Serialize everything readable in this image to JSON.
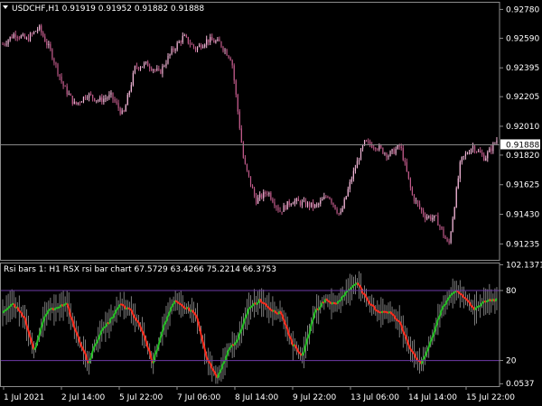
{
  "header": {
    "menu_icon": "triangle-down-icon",
    "title": "USDCHF,H1  0.91919 0.91952 0.91882 0.91888"
  },
  "indicator_header": "Rsi bars 1: H1 RSX rsi bar chart 67.5729 63.4266 75.2214 66.3753",
  "current_price_tag": "0.91888",
  "colors": {
    "background": "#000000",
    "bull_candle": "#f4b6d8",
    "bear_candle": "#c05a8a",
    "rsx_up": "#22c022",
    "rsx_down": "#ff2a1a",
    "hist_bars": "#9a9a9a",
    "level_lines": "#6e3aa8",
    "axis_frame": "#8c8c8c",
    "price_line": "#888888"
  },
  "chart_data": [
    {
      "type": "line",
      "title": "USDCHF,H1  0.91919 0.91952 0.91882 0.91888",
      "subtype": "candlestick",
      "yticks": [
        "0.92780",
        "0.92590",
        "0.92395",
        "0.92205",
        "0.92010",
        "0.91820",
        "0.91625",
        "0.91430",
        "0.91235"
      ],
      "ylim": [
        0.9113,
        0.9283
      ],
      "current_price": 0.91888,
      "x_keypoints": [
        0,
        0.02,
        0.05,
        0.08,
        0.1,
        0.12,
        0.14,
        0.16,
        0.2,
        0.24,
        0.26,
        0.3,
        0.33,
        0.36,
        0.4,
        0.41,
        0.42,
        0.44,
        0.48,
        0.5,
        0.53,
        0.56,
        0.6,
        0.63,
        0.67,
        0.7,
        0.72,
        0.74,
        0.77,
        0.79,
        0.8,
        0.82,
        0.85,
        0.88,
        0.9,
        0.92,
        0.95,
        1.0
      ],
      "y_keypoints": [
        0.9255,
        0.9262,
        0.9258,
        0.9266,
        0.925,
        0.9228,
        0.9215,
        0.9222,
        0.9218,
        0.9221,
        0.9208,
        0.924,
        0.9242,
        0.9236,
        0.925,
        0.926,
        0.9252,
        0.9258,
        0.9256,
        0.9245,
        0.9178,
        0.9152,
        0.9158,
        0.9145,
        0.9152,
        0.915,
        0.9148,
        0.9156,
        0.9142,
        0.9168,
        0.919,
        0.9188,
        0.9182,
        0.9188,
        0.9155,
        0.9142,
        0.914,
        0.9122,
        0.9178,
        0.9188,
        0.918,
        0.9192
      ]
    },
    {
      "type": "bar",
      "title": "Rsi bars 1: H1 RSX rsi bar chart 67.5729 63.4266 75.2214 66.3753",
      "yticks": [
        "102.1371",
        "80",
        "20",
        "0.0537"
      ],
      "ylim": [
        -2,
        104
      ],
      "levels": [
        20,
        80
      ],
      "x_keypoints": [
        0,
        0.02,
        0.04,
        0.06,
        0.09,
        0.12,
        0.15,
        0.18,
        0.22,
        0.25,
        0.28,
        0.31,
        0.35,
        0.38,
        0.42,
        0.44,
        0.46,
        0.5,
        0.52,
        0.55,
        0.58,
        0.6,
        0.63,
        0.66,
        0.69,
        0.72,
        0.74,
        0.76,
        0.78,
        0.8,
        0.83,
        0.86,
        0.89,
        0.91,
        0.93,
        0.96,
        0.98,
        1.0
      ],
      "rsx_keypoints": [
        62,
        68,
        58,
        28,
        60,
        66,
        68,
        40,
        18,
        42,
        54,
        68,
        62,
        46,
        18,
        50,
        70,
        66,
        60,
        22,
        4,
        28,
        40,
        66,
        72,
        64,
        60,
        34,
        24,
        60,
        72,
        68,
        78,
        88,
        70,
        62,
        62,
        52,
        30,
        16,
        40,
        66,
        80,
        74,
        64,
        72,
        72
      ]
    }
  ],
  "x_axis_labels": [
    "1 Jul 2021",
    "2 Jul 14:00",
    "5 Jul 22:00",
    "7 Jul 06:00",
    "8 Jul 14:00",
    "9 Jul 22:00",
    "13 Jul 06:00",
    "14 Jul 14:00",
    "15 Jul 22:00"
  ]
}
